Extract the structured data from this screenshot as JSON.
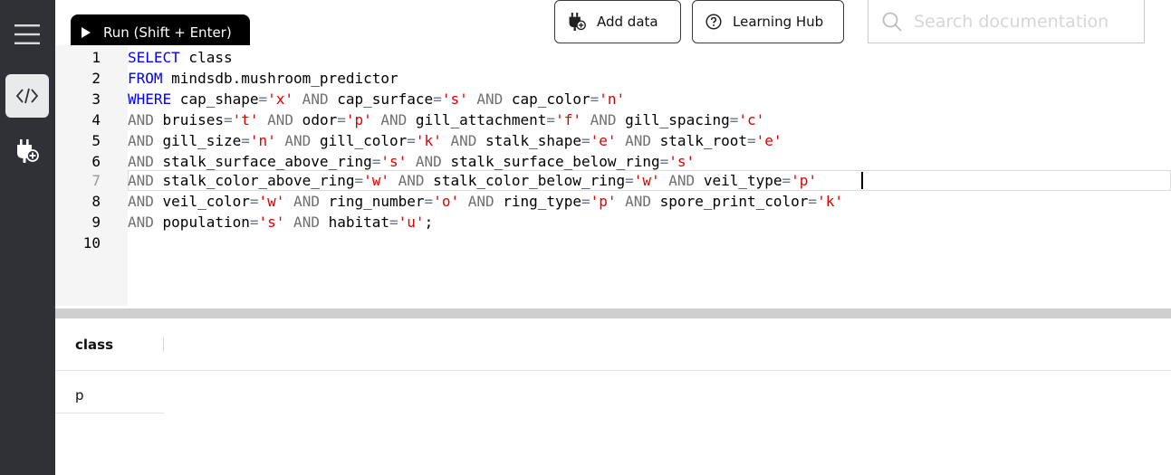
{
  "sidebar": {
    "items": [
      {
        "icon": "menu-icon"
      },
      {
        "icon": "code-icon",
        "active": true
      },
      {
        "icon": "plug-icon"
      }
    ]
  },
  "toolbar": {
    "run_label": "Run (Shift + Enter)",
    "add_data_label": "Add data",
    "learning_hub_label": "Learning Hub",
    "search_placeholder": "Search documentation"
  },
  "editor": {
    "line_numbers": [
      "1",
      "2",
      "3",
      "4",
      "5",
      "6",
      "7",
      "8",
      "9",
      "10"
    ],
    "active_line": 7
  },
  "results": {
    "columns": [
      "class"
    ],
    "rows": [
      [
        "p"
      ]
    ]
  }
}
